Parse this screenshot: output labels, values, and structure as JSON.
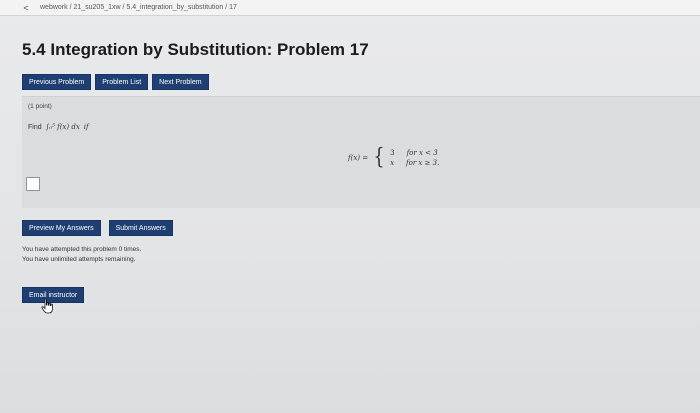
{
  "breadcrumb": {
    "back_label": "<",
    "path": "webwork / 21_su205_1xw / 5.4_integration_by_substitution / 17"
  },
  "page_title": "5.4 Integration by Substitution: Problem 17",
  "nav": {
    "previous": "Previous Problem",
    "list": "Problem List",
    "next": "Next Problem"
  },
  "problem": {
    "points": "(1 point)",
    "find_label": "Find",
    "integral": "∫₀⁵ f(x) dx",
    "if_label": "if",
    "function_lhs": "f(x) =",
    "cases": [
      {
        "expr": "3",
        "cond": "for x < 3"
      },
      {
        "expr": "x",
        "cond": "for x ≥ 3."
      }
    ]
  },
  "actions": {
    "preview": "Preview My Answers",
    "submit": "Submit Answers"
  },
  "attempts": {
    "line1": "You have attempted this problem 0 times.",
    "line2": "You have unlimited attempts remaining."
  },
  "email_label": "Email instructor",
  "colors": {
    "button_bg": "#1f3f73",
    "problem_bg": "#dbdcdd",
    "page_bg": "#e6e7e9"
  }
}
